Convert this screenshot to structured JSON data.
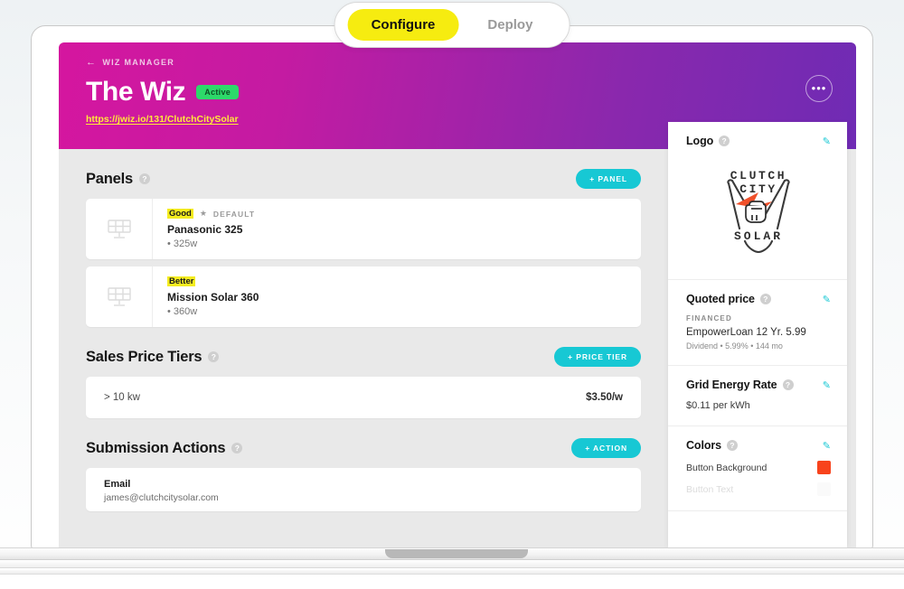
{
  "tabs": [
    {
      "label": "Configure",
      "active": true
    },
    {
      "label": "Deploy",
      "active": false
    }
  ],
  "header": {
    "breadcrumb_arrow": "←",
    "breadcrumb": "WIZ MANAGER",
    "title": "The Wiz",
    "status": "Active",
    "url": "https://jwiz.io/131/ClutchCitySolar",
    "more_label": "•••"
  },
  "help_glyph": "?",
  "main": {
    "panels": {
      "title": "Panels",
      "add_label": "+ PANEL",
      "items": [
        {
          "tag": "Good",
          "default_label": "DEFAULT",
          "star": "★",
          "is_default": true,
          "name": "Panasonic 325",
          "spec": "• 325w"
        },
        {
          "tag": "Better",
          "default_label": "",
          "star": "",
          "is_default": false,
          "name": "Mission Solar 360",
          "spec": "• 360w"
        }
      ]
    },
    "price_tiers": {
      "title": "Sales Price Tiers",
      "add_label": "+ PRICE TIER",
      "rows": [
        {
          "range": "> 10 kw",
          "price": "$3.50/w"
        }
      ]
    },
    "submission_actions": {
      "title": "Submission Actions",
      "add_label": "+ ACTION",
      "items": [
        {
          "type": "Email",
          "value": "james@clutchcitysolar.com"
        }
      ]
    }
  },
  "sidebar": {
    "logo": {
      "title": "Logo",
      "edit": "✎",
      "line1": "CLUTCH",
      "line2": "CITY",
      "line3": "SOLAR"
    },
    "quoted_price": {
      "title": "Quoted price",
      "edit": "✎",
      "kicker": "FINANCED",
      "plan": "EmpowerLoan 12 Yr. 5.99",
      "details": "Dividend • 5.99% • 144 mo"
    },
    "grid_rate": {
      "title": "Grid Energy Rate",
      "edit": "✎",
      "value": "$0.11 per kWh"
    },
    "colors": {
      "title": "Colors",
      "edit": "✎",
      "rows": [
        {
          "label": "Button Background",
          "hex": "#f8431c"
        },
        {
          "label": "Button Text",
          "hex": "#e4e4e4"
        }
      ]
    }
  }
}
